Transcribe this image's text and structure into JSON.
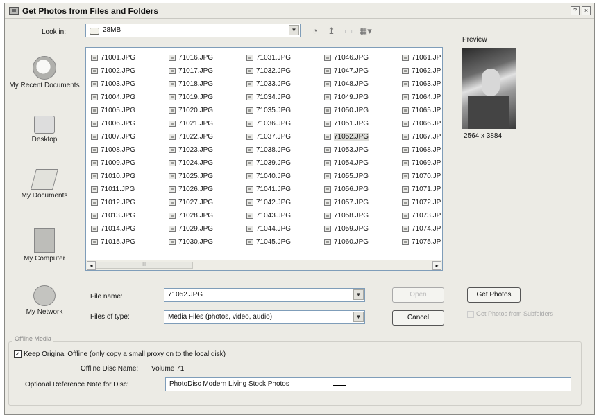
{
  "window": {
    "title": "Get Photos from Files and Folders",
    "help_label": "?",
    "close_label": "×"
  },
  "lookin": {
    "label": "Look in:",
    "value": "28MB"
  },
  "toolbar": {
    "back_icon": "back-icon",
    "up_icon": "up-folder-icon",
    "new_folder_icon": "new-folder-icon",
    "views_icon": "views-menu-icon"
  },
  "places": [
    {
      "label": "My Recent Documents",
      "icon": "recent-documents-icon"
    },
    {
      "label": "Desktop",
      "icon": "desktop-icon"
    },
    {
      "label": "My Documents",
      "icon": "my-documents-icon"
    },
    {
      "label": "My Computer",
      "icon": "my-computer-icon"
    },
    {
      "label": "My Network",
      "icon": "my-network-icon"
    }
  ],
  "files": {
    "columns": [
      [
        "71001.JPG",
        "71002.JPG",
        "71003.JPG",
        "71004.JPG",
        "71005.JPG",
        "71006.JPG",
        "71007.JPG",
        "71008.JPG",
        "71009.JPG",
        "71010.JPG",
        "71011.JPG",
        "71012.JPG",
        "71013.JPG",
        "71014.JPG",
        "71015.JPG"
      ],
      [
        "71016.JPG",
        "71017.JPG",
        "71018.JPG",
        "71019.JPG",
        "71020.JPG",
        "71021.JPG",
        "71022.JPG",
        "71023.JPG",
        "71024.JPG",
        "71025.JPG",
        "71026.JPG",
        "71027.JPG",
        "71028.JPG",
        "71029.JPG",
        "71030.JPG"
      ],
      [
        "71031.JPG",
        "71032.JPG",
        "71033.JPG",
        "71034.JPG",
        "71035.JPG",
        "71036.JPG",
        "71037.JPG",
        "71038.JPG",
        "71039.JPG",
        "71040.JPG",
        "71041.JPG",
        "71042.JPG",
        "71043.JPG",
        "71044.JPG",
        "71045.JPG"
      ],
      [
        "71046.JPG",
        "71047.JPG",
        "71048.JPG",
        "71049.JPG",
        "71050.JPG",
        "71051.JPG",
        "71052.JPG",
        "71053.JPG",
        "71054.JPG",
        "71055.JPG",
        "71056.JPG",
        "71057.JPG",
        "71058.JPG",
        "71059.JPG",
        "71060.JPG"
      ],
      [
        "71061.JP",
        "71062.JP",
        "71063.JP",
        "71064.JP",
        "71065.JP",
        "71066.JP",
        "71067.JP",
        "71068.JP",
        "71069.JP",
        "71070.JP",
        "71071.JP",
        "71072.JP",
        "71073.JP",
        "71074.JP",
        "71075.JP"
      ]
    ],
    "selected": "71052.JPG"
  },
  "scrollbar": {
    "left_arrow": "◂",
    "right_arrow": "▸",
    "thumb_grip": "III"
  },
  "preview": {
    "label": "Preview",
    "dimensions": "2564 x 3884"
  },
  "filename": {
    "label": "File name:",
    "value": "71052.JPG"
  },
  "filetype": {
    "label": "Files of type:",
    "value": "Media Files (photos, video, audio)"
  },
  "buttons": {
    "open": "Open",
    "cancel": "Cancel",
    "get_photos": "Get Photos"
  },
  "subfolders": {
    "label": "Get Photos from Subfolders",
    "checked": true,
    "enabled": false
  },
  "offline": {
    "group_title": "Offline Media",
    "keep_label": "Keep Original Offline (only copy a small proxy on to the local disk)",
    "keep_checked": true,
    "disc_name_label": "Offline Disc Name:",
    "disc_name_value": "Volume 71",
    "note_label": "Optional Reference Note for Disc:",
    "note_value": "PhotoDisc Modern Living Stock Photos"
  }
}
